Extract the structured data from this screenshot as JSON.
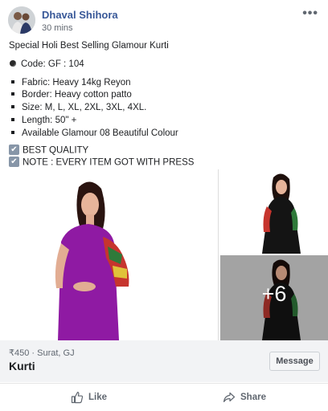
{
  "post": {
    "author": "Dhaval Shihora",
    "time": "30 mins",
    "more": "•••",
    "lines": [
      "Special Holi Best Selling Glamour Kurti",
      "Code: GF : 104",
      "Fabric: Heavy 14kg Reyon",
      "Border: Heavy cotton patto",
      "Size: M, L, XL, 2XL, 3XL, 4XL.",
      "Length: 50\" +",
      "Available Glamour 08 Beautiful Colour",
      "BEST QUALITY",
      "NOTE : EVERY ITEM GOT WITH PRESS"
    ]
  },
  "photos": {
    "more_count": "+6"
  },
  "listing": {
    "price_location": "₹450 · Surat, GJ",
    "title": "Kurti",
    "message_label": "Message"
  },
  "actions": {
    "like_label": "Like",
    "share_label": "Share"
  },
  "colors": {
    "author": "#385898",
    "kurti_main": "#8f1aa3",
    "kurti_dark": "#141414",
    "sleeve_red": "#c6352e",
    "sleeve_green": "#2f7a3a"
  }
}
